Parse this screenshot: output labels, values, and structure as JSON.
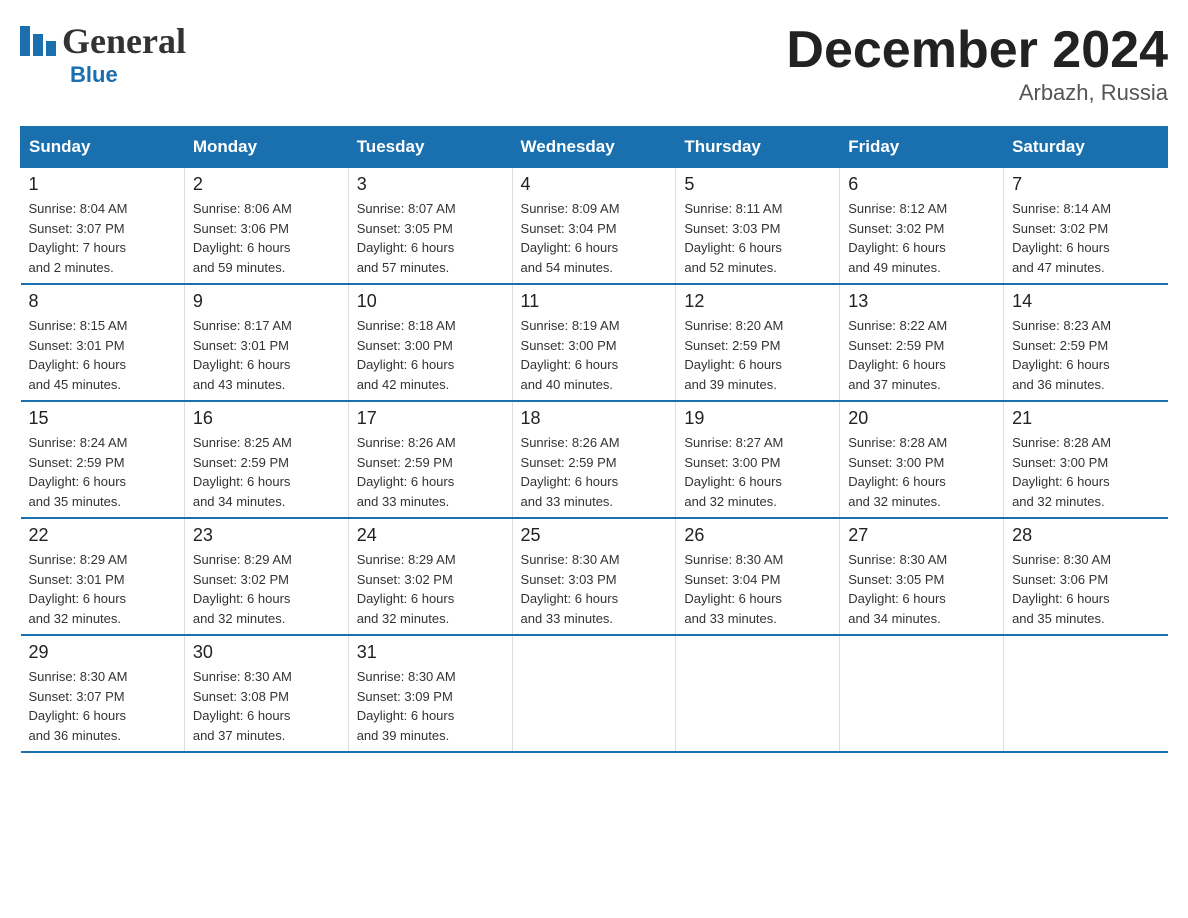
{
  "header": {
    "logo_general": "General",
    "logo_blue": "Blue",
    "title": "December 2024",
    "location": "Arbazh, Russia"
  },
  "days_of_week": [
    "Sunday",
    "Monday",
    "Tuesday",
    "Wednesday",
    "Thursday",
    "Friday",
    "Saturday"
  ],
  "weeks": [
    [
      {
        "day": "1",
        "info": "Sunrise: 8:04 AM\nSunset: 3:07 PM\nDaylight: 7 hours\nand 2 minutes."
      },
      {
        "day": "2",
        "info": "Sunrise: 8:06 AM\nSunset: 3:06 PM\nDaylight: 6 hours\nand 59 minutes."
      },
      {
        "day": "3",
        "info": "Sunrise: 8:07 AM\nSunset: 3:05 PM\nDaylight: 6 hours\nand 57 minutes."
      },
      {
        "day": "4",
        "info": "Sunrise: 8:09 AM\nSunset: 3:04 PM\nDaylight: 6 hours\nand 54 minutes."
      },
      {
        "day": "5",
        "info": "Sunrise: 8:11 AM\nSunset: 3:03 PM\nDaylight: 6 hours\nand 52 minutes."
      },
      {
        "day": "6",
        "info": "Sunrise: 8:12 AM\nSunset: 3:02 PM\nDaylight: 6 hours\nand 49 minutes."
      },
      {
        "day": "7",
        "info": "Sunrise: 8:14 AM\nSunset: 3:02 PM\nDaylight: 6 hours\nand 47 minutes."
      }
    ],
    [
      {
        "day": "8",
        "info": "Sunrise: 8:15 AM\nSunset: 3:01 PM\nDaylight: 6 hours\nand 45 minutes."
      },
      {
        "day": "9",
        "info": "Sunrise: 8:17 AM\nSunset: 3:01 PM\nDaylight: 6 hours\nand 43 minutes."
      },
      {
        "day": "10",
        "info": "Sunrise: 8:18 AM\nSunset: 3:00 PM\nDaylight: 6 hours\nand 42 minutes."
      },
      {
        "day": "11",
        "info": "Sunrise: 8:19 AM\nSunset: 3:00 PM\nDaylight: 6 hours\nand 40 minutes."
      },
      {
        "day": "12",
        "info": "Sunrise: 8:20 AM\nSunset: 2:59 PM\nDaylight: 6 hours\nand 39 minutes."
      },
      {
        "day": "13",
        "info": "Sunrise: 8:22 AM\nSunset: 2:59 PM\nDaylight: 6 hours\nand 37 minutes."
      },
      {
        "day": "14",
        "info": "Sunrise: 8:23 AM\nSunset: 2:59 PM\nDaylight: 6 hours\nand 36 minutes."
      }
    ],
    [
      {
        "day": "15",
        "info": "Sunrise: 8:24 AM\nSunset: 2:59 PM\nDaylight: 6 hours\nand 35 minutes."
      },
      {
        "day": "16",
        "info": "Sunrise: 8:25 AM\nSunset: 2:59 PM\nDaylight: 6 hours\nand 34 minutes."
      },
      {
        "day": "17",
        "info": "Sunrise: 8:26 AM\nSunset: 2:59 PM\nDaylight: 6 hours\nand 33 minutes."
      },
      {
        "day": "18",
        "info": "Sunrise: 8:26 AM\nSunset: 2:59 PM\nDaylight: 6 hours\nand 33 minutes."
      },
      {
        "day": "19",
        "info": "Sunrise: 8:27 AM\nSunset: 3:00 PM\nDaylight: 6 hours\nand 32 minutes."
      },
      {
        "day": "20",
        "info": "Sunrise: 8:28 AM\nSunset: 3:00 PM\nDaylight: 6 hours\nand 32 minutes."
      },
      {
        "day": "21",
        "info": "Sunrise: 8:28 AM\nSunset: 3:00 PM\nDaylight: 6 hours\nand 32 minutes."
      }
    ],
    [
      {
        "day": "22",
        "info": "Sunrise: 8:29 AM\nSunset: 3:01 PM\nDaylight: 6 hours\nand 32 minutes."
      },
      {
        "day": "23",
        "info": "Sunrise: 8:29 AM\nSunset: 3:02 PM\nDaylight: 6 hours\nand 32 minutes."
      },
      {
        "day": "24",
        "info": "Sunrise: 8:29 AM\nSunset: 3:02 PM\nDaylight: 6 hours\nand 32 minutes."
      },
      {
        "day": "25",
        "info": "Sunrise: 8:30 AM\nSunset: 3:03 PM\nDaylight: 6 hours\nand 33 minutes."
      },
      {
        "day": "26",
        "info": "Sunrise: 8:30 AM\nSunset: 3:04 PM\nDaylight: 6 hours\nand 33 minutes."
      },
      {
        "day": "27",
        "info": "Sunrise: 8:30 AM\nSunset: 3:05 PM\nDaylight: 6 hours\nand 34 minutes."
      },
      {
        "day": "28",
        "info": "Sunrise: 8:30 AM\nSunset: 3:06 PM\nDaylight: 6 hours\nand 35 minutes."
      }
    ],
    [
      {
        "day": "29",
        "info": "Sunrise: 8:30 AM\nSunset: 3:07 PM\nDaylight: 6 hours\nand 36 minutes."
      },
      {
        "day": "30",
        "info": "Sunrise: 8:30 AM\nSunset: 3:08 PM\nDaylight: 6 hours\nand 37 minutes."
      },
      {
        "day": "31",
        "info": "Sunrise: 8:30 AM\nSunset: 3:09 PM\nDaylight: 6 hours\nand 39 minutes."
      },
      {
        "day": "",
        "info": ""
      },
      {
        "day": "",
        "info": ""
      },
      {
        "day": "",
        "info": ""
      },
      {
        "day": "",
        "info": ""
      }
    ]
  ],
  "colors": {
    "header_bg": "#1a6faf",
    "border": "#1a6faf",
    "text_dark": "#222222",
    "text_location": "#555555"
  }
}
